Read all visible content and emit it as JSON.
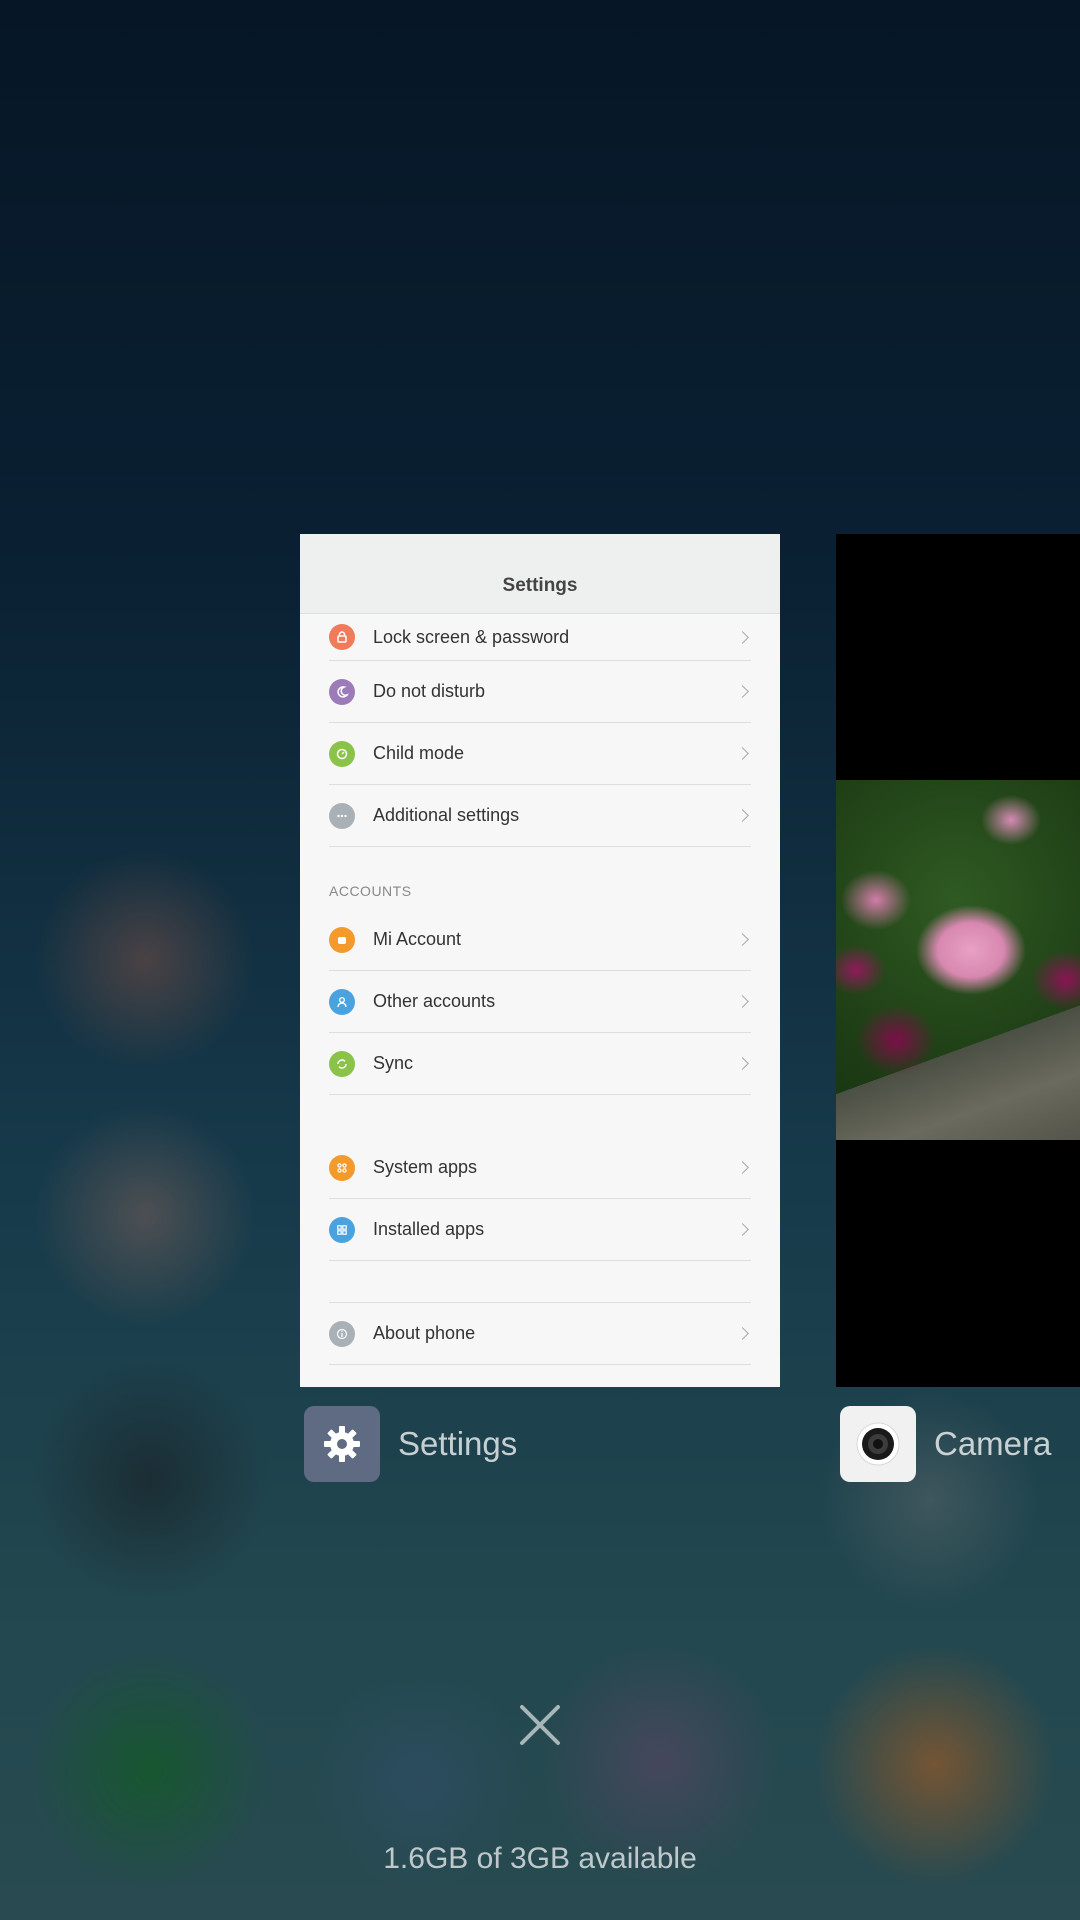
{
  "settings_card": {
    "title": "Settings",
    "rows_top": [
      {
        "label": "Lock screen & password",
        "icon": "lock-icon",
        "color": "#f07a5a"
      },
      {
        "label": "Do not disturb",
        "icon": "moon-icon",
        "color": "#9b7bb8"
      },
      {
        "label": "Child mode",
        "icon": "child-mode-icon",
        "color": "#8bc34a"
      },
      {
        "label": "Additional settings",
        "icon": "more-icon",
        "color": "#a9b0b6"
      }
    ],
    "accounts_section": "ACCOUNTS",
    "rows_accounts": [
      {
        "label": "Mi Account",
        "icon": "mi-icon",
        "color": "#f39a2d"
      },
      {
        "label": "Other accounts",
        "icon": "user-icon",
        "color": "#4aa3df"
      },
      {
        "label": "Sync",
        "icon": "sync-icon",
        "color": "#8bc34a"
      }
    ],
    "rows_apps": [
      {
        "label": "System apps",
        "icon": "grid-icon",
        "color": "#f39a2d"
      },
      {
        "label": "Installed apps",
        "icon": "apps-icon",
        "color": "#4aa3df"
      }
    ],
    "rows_about": [
      {
        "label": "About phone",
        "icon": "info-icon",
        "color": "#a9b0b6"
      }
    ]
  },
  "apps": {
    "settings_name": "Settings",
    "camera_name": "Camera"
  },
  "memory_text": "1.6GB of 3GB available"
}
